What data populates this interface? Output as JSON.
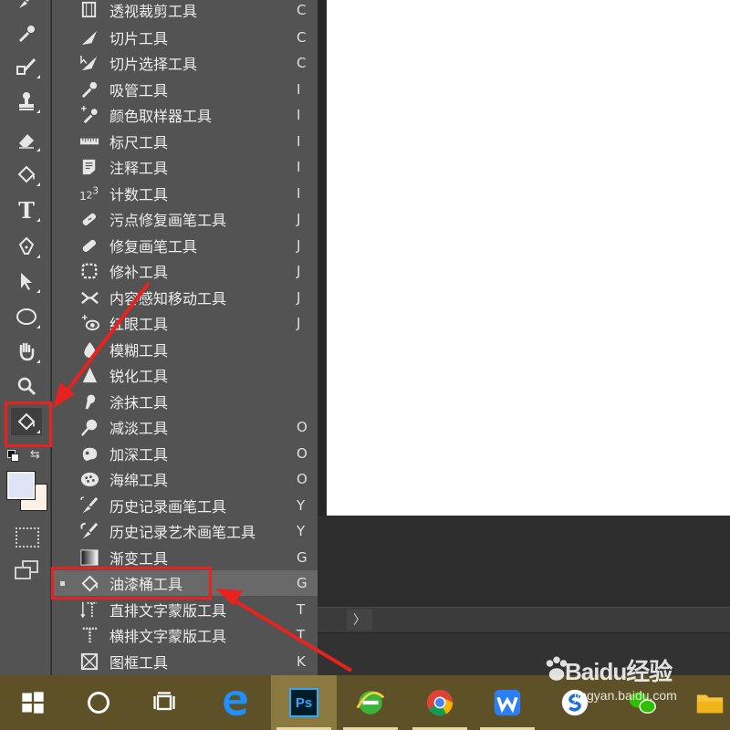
{
  "menu": {
    "items": [
      {
        "label": "透视裁剪工具",
        "shortcut": "C",
        "icon": "perspective-crop-icon"
      },
      {
        "label": "切片工具",
        "shortcut": "C",
        "icon": "slice-icon"
      },
      {
        "label": "切片选择工具",
        "shortcut": "C",
        "icon": "slice-select-icon"
      },
      {
        "label": "吸管工具",
        "shortcut": "I",
        "icon": "eyedropper-icon"
      },
      {
        "label": "颜色取样器工具",
        "shortcut": "I",
        "icon": "color-sampler-icon"
      },
      {
        "label": "标尺工具",
        "shortcut": "I",
        "icon": "ruler-icon"
      },
      {
        "label": "注释工具",
        "shortcut": "I",
        "icon": "note-icon"
      },
      {
        "label": "计数工具",
        "shortcut": "I",
        "icon": "count-icon"
      },
      {
        "label": "污点修复画笔工具",
        "shortcut": "J",
        "icon": "spot-healing-icon"
      },
      {
        "label": "修复画笔工具",
        "shortcut": "J",
        "icon": "healing-brush-icon"
      },
      {
        "label": "修补工具",
        "shortcut": "J",
        "icon": "patch-icon"
      },
      {
        "label": "内容感知移动工具",
        "shortcut": "J",
        "icon": "content-aware-move-icon"
      },
      {
        "label": "红眼工具",
        "shortcut": "J",
        "icon": "red-eye-icon"
      },
      {
        "label": "模糊工具",
        "shortcut": "",
        "icon": "blur-icon"
      },
      {
        "label": "锐化工具",
        "shortcut": "",
        "icon": "sharpen-icon"
      },
      {
        "label": "涂抹工具",
        "shortcut": "",
        "icon": "smudge-icon"
      },
      {
        "label": "减淡工具",
        "shortcut": "O",
        "icon": "dodge-icon"
      },
      {
        "label": "加深工具",
        "shortcut": "O",
        "icon": "burn-icon"
      },
      {
        "label": "海绵工具",
        "shortcut": "O",
        "icon": "sponge-icon"
      },
      {
        "label": "历史记录画笔工具",
        "shortcut": "Y",
        "icon": "history-brush-icon"
      },
      {
        "label": "历史记录艺术画笔工具",
        "shortcut": "Y",
        "icon": "art-history-brush-icon"
      },
      {
        "label": "渐变工具",
        "shortcut": "G",
        "icon": "gradient-icon"
      },
      {
        "label": "油漆桶工具",
        "shortcut": "G",
        "icon": "paint-bucket-icon",
        "selected": true
      },
      {
        "label": "直排文字蒙版工具",
        "shortcut": "T",
        "icon": "vertical-type-mask-icon"
      },
      {
        "label": "横排文字蒙版工具",
        "shortcut": "T",
        "icon": "horizontal-type-mask-icon"
      },
      {
        "label": "图框工具",
        "shortcut": "K",
        "icon": "frame-icon"
      }
    ]
  },
  "toolbar": {
    "type_glyph": "T",
    "tools": [
      "brush-icon",
      "eyedropper-icon",
      "history-brush-icon",
      "stamp-icon",
      "eraser-icon",
      "paint-bucket-icon",
      "type-icon",
      "pen-icon",
      "path-select-icon",
      "ellipse-icon",
      "hand-icon",
      "zoom-icon",
      "paint-bucket-icon"
    ],
    "foreground_color": "#dfe3f5",
    "background_color": "#fbf0e6"
  },
  "status": {
    "chevron": "〉"
  },
  "taskbar": {
    "items": [
      "windows-start-icon",
      "cortana-icon",
      "task-view-icon",
      "edge-icon",
      "photoshop-icon",
      "ie-icon",
      "chrome-icon",
      "wps-icon",
      "sogou-icon",
      "wechat-icon",
      "folder-icon"
    ],
    "photoshop_label": "Ps"
  },
  "watermark": {
    "title": "Baidu经验",
    "subtitle": "jingyan.baidu.com"
  },
  "colors": {
    "highlight": "#e8221e",
    "panel": "#535353",
    "taskbar": "#5e5128"
  }
}
